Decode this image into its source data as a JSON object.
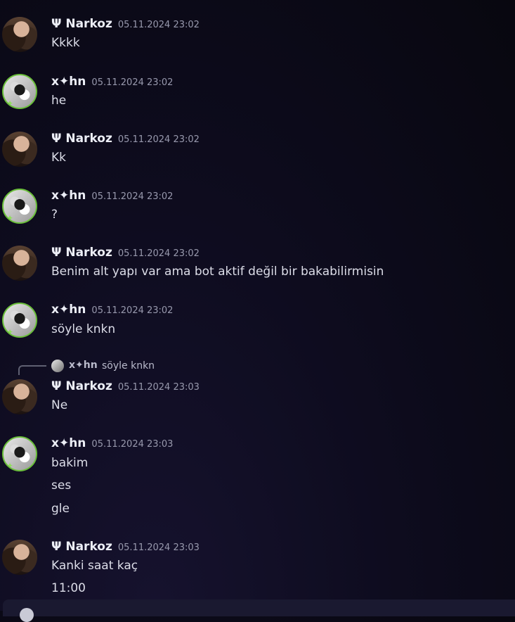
{
  "users": {
    "narkoz": "Ψ Narkoz",
    "xhn": "x✦hn"
  },
  "messages": [
    {
      "author": "Ψ Narkoz",
      "time": "05.11.2024 23:02",
      "lines": [
        "Kkkk"
      ]
    },
    {
      "author": "x✦hn",
      "time": "05.11.2024 23:02",
      "lines": [
        "he"
      ]
    },
    {
      "author": "Ψ Narkoz",
      "time": "05.11.2024 23:02",
      "lines": [
        "Kk"
      ]
    },
    {
      "author": "x✦hn",
      "time": "05.11.2024 23:02",
      "lines": [
        "?"
      ]
    },
    {
      "author": "Ψ Narkoz",
      "time": "05.11.2024 23:02",
      "lines": [
        "Benim alt yapı var ama bot aktif değil bir bakabilirmisin"
      ]
    },
    {
      "author": "x✦hn",
      "time": "05.11.2024 23:02",
      "lines": [
        "söyle knkn"
      ]
    },
    {
      "author": "Ψ Narkoz",
      "time": "05.11.2024 23:03",
      "lines": [
        "Ne"
      ],
      "reply": {
        "author": "x✦hn",
        "text": "söyle knkn"
      }
    },
    {
      "author": "x✦hn",
      "time": "05.11.2024 23:03",
      "lines": [
        "bakim",
        "ses",
        "gle"
      ]
    },
    {
      "author": "Ψ Narkoz",
      "time": "05.11.2024 23:03",
      "lines": [
        "Kanki saat kaç",
        "11:00"
      ]
    }
  ],
  "colors": {
    "background": "#0e0c1f",
    "username": "#eceef6",
    "timestamp": "#9899ad",
    "message_text": "#dcdde8",
    "status_green": "#6abf3a"
  }
}
